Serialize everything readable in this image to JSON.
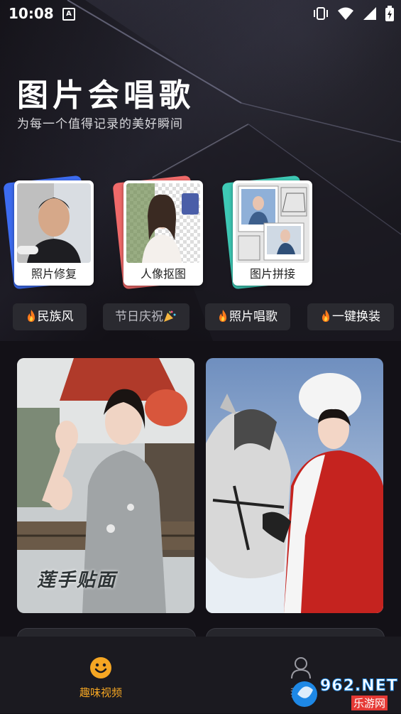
{
  "status": {
    "time": "10:08",
    "notif_letter": "A"
  },
  "hero": {
    "title": "图片会唱歌",
    "subtitle": "为每一个值得记录的美好瞬间"
  },
  "features": [
    {
      "label": "照片修复",
      "accent": "#3d6cf0"
    },
    {
      "label": "人像抠图",
      "accent": "#f06a6a"
    },
    {
      "label": "图片拼接",
      "accent": "#3ec9b5"
    }
  ],
  "chips": [
    {
      "label": "民族风",
      "icon": "fire-icon"
    },
    {
      "label": "节日庆祝",
      "icon": "party-icon"
    },
    {
      "label": "照片唱歌",
      "icon": "fire-icon"
    },
    {
      "label": "一键换装",
      "icon": "fire-icon"
    }
  ],
  "videos": [
    {
      "overlay_text": "莲手贴面"
    },
    {
      "overlay_text": ""
    }
  ],
  "tabs": [
    {
      "label": "趣味视频",
      "active": true,
      "color": "#f5a623"
    },
    {
      "label": "我的",
      "active": false
    }
  ],
  "watermark": {
    "brand": "962.NET",
    "sub": "乐游网"
  }
}
